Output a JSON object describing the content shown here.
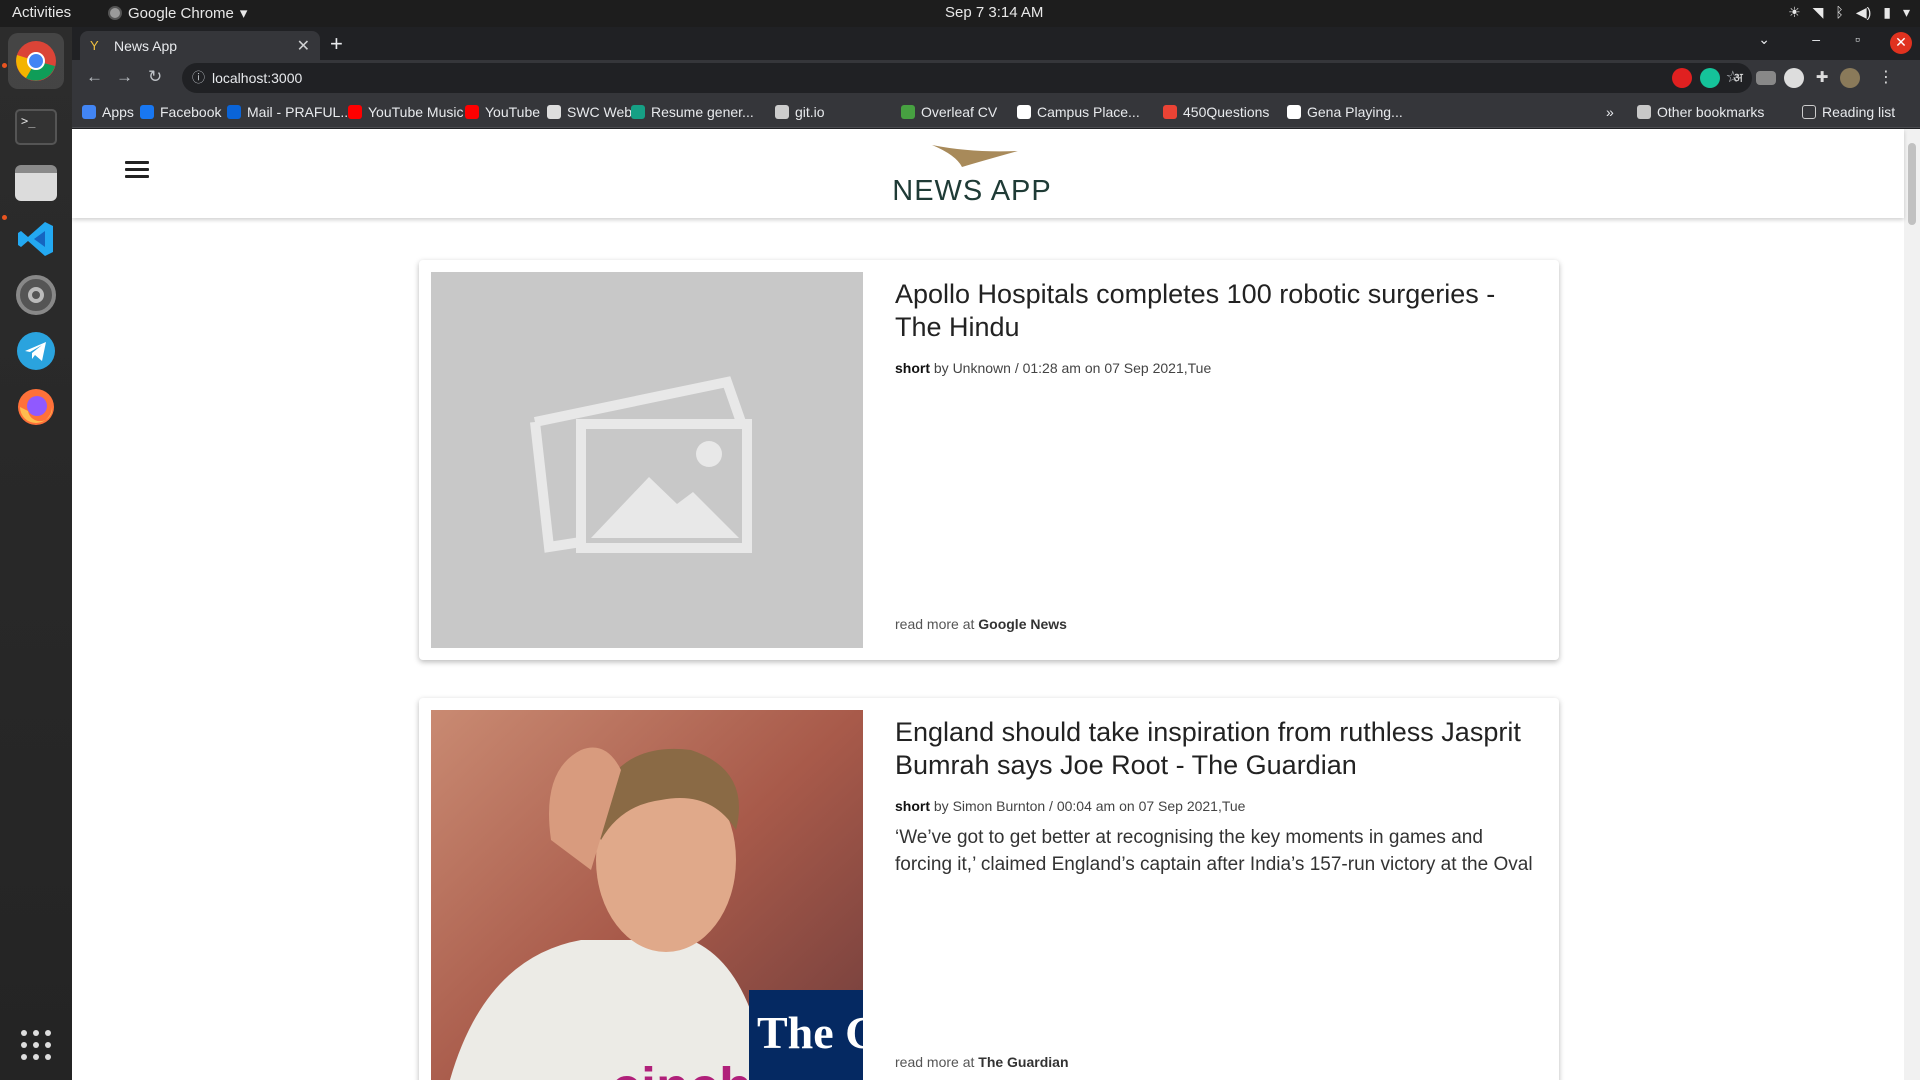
{
  "system": {
    "activities": "Activities",
    "app_name": "Google Chrome",
    "clock": "Sep 7  3:14 AM"
  },
  "browser": {
    "tab_title": "News App",
    "url": "localhost:3000",
    "bookmarks": [
      {
        "label": "Apps",
        "color": "#4285f4"
      },
      {
        "label": "Facebook",
        "color": "#1877f2"
      },
      {
        "label": "Mail - PRAFUL...",
        "color": "#0a64d8"
      },
      {
        "label": "YouTube Music",
        "color": "#ff0000"
      },
      {
        "label": "YouTube",
        "color": "#ff0000"
      },
      {
        "label": "SWC WebD",
        "color": "#dddddd"
      },
      {
        "label": "Resume gener...",
        "color": "#16a085"
      },
      {
        "label": "git.io",
        "color": "#cccccc"
      },
      {
        "label": "Overleaf CV",
        "color": "#47a141"
      },
      {
        "label": "Campus Place...",
        "color": "#ffffff"
      },
      {
        "label": "450Questions",
        "color": "#ea4335"
      },
      {
        "label": "Gena Playing...",
        "color": "#ffffff"
      }
    ],
    "overflow": "»",
    "other_bookmarks": "Other bookmarks",
    "reading_list": "Reading list"
  },
  "app": {
    "logo_text": "NEWS APP"
  },
  "articles": [
    {
      "headline": "Apollo Hospitals completes 100 robotic surgeries - The Hindu",
      "tag": "short",
      "meta": " by Unknown / 01:28 am on 07 Sep 2021,Tue",
      "description": "",
      "readmore_prefix": "read more at ",
      "source": "Google News"
    },
    {
      "headline": "England should take inspiration from ruthless Jasprit Bumrah says Joe Root - The Guardian",
      "tag": "short",
      "meta": " by Simon Burnton / 00:04 am on 07 Sep 2021,Tue",
      "description": "‘We’ve got to get better at recognising the key moments in games and forcing it,’ claimed England’s captain after India’s 157-run victory at the Oval",
      "readmore_prefix": "read more at ",
      "source": "The Guardian",
      "image_caption": "The Guar"
    }
  ]
}
